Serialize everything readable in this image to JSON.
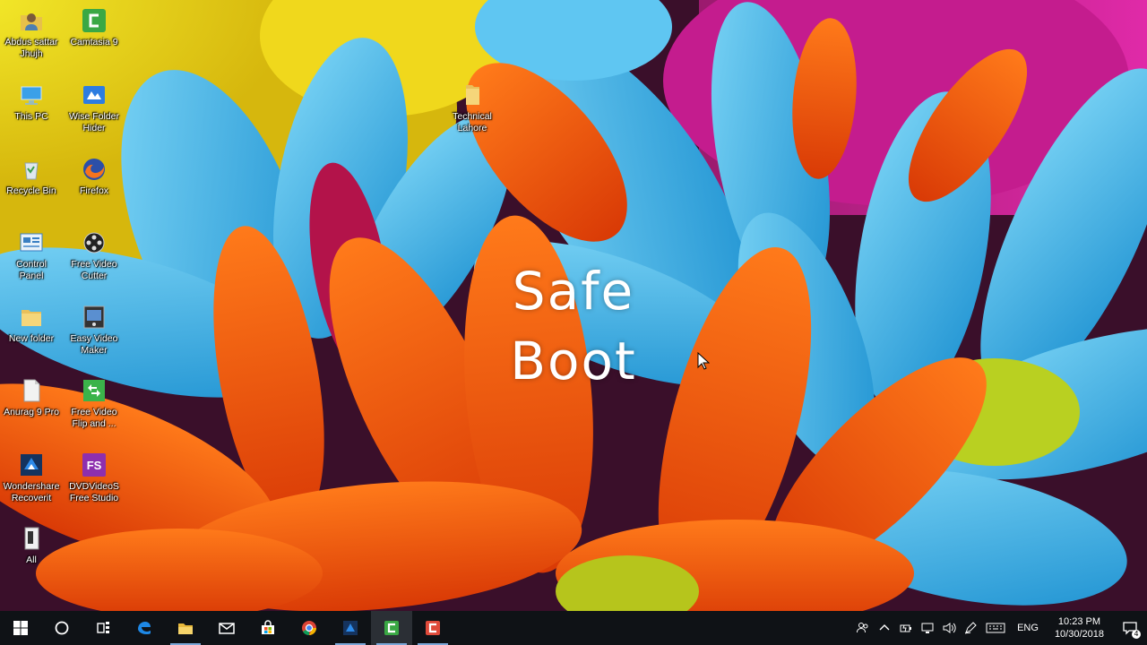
{
  "desktop": {
    "icons": [
      {
        "id": "abdus",
        "label": "Abdus sattar\nJhujh",
        "icon": "user-folder-icon"
      },
      {
        "id": "camtasia",
        "label": "Camtasia 9",
        "icon": "camtasia-icon"
      },
      {
        "id": "thispc",
        "label": "This PC",
        "icon": "computer-icon"
      },
      {
        "id": "wisefolder",
        "label": "Wise Folder\nHider",
        "icon": "wise-folder-icon"
      },
      {
        "id": "recycle",
        "label": "Recycle Bin",
        "icon": "recycle-bin-icon"
      },
      {
        "id": "firefox",
        "label": "Firefox",
        "icon": "firefox-icon"
      },
      {
        "id": "control",
        "label": "Control\nPanel",
        "icon": "control-panel-icon"
      },
      {
        "id": "fvcutter",
        "label": "Free Video\nCutter",
        "icon": "film-reel-icon"
      },
      {
        "id": "newfolder",
        "label": "New folder",
        "icon": "folder-icon"
      },
      {
        "id": "easyvideo",
        "label": "Easy Video\nMaker",
        "icon": "video-maker-icon"
      },
      {
        "id": "anurag",
        "label": "Anurag 9 Pro",
        "icon": "document-icon"
      },
      {
        "id": "fvflip",
        "label": "Free Video\nFlip and ...",
        "icon": "video-flip-icon"
      },
      {
        "id": "wondershare",
        "label": "Wondershare\nRecoverit",
        "icon": "recoverit-icon"
      },
      {
        "id": "dvdvideosoft",
        "label": "DVDVideoS\nFree Studio",
        "icon": "free-studio-icon"
      },
      {
        "id": "all",
        "label": "All",
        "icon": "document-icon"
      },
      {
        "id": "technical",
        "label": "Technical\nLahore",
        "icon": "folder-icon"
      }
    ],
    "free_studio_badge": "FS"
  },
  "overlay": {
    "line1": "Safe",
    "line2": "Boot"
  },
  "taskbar": {
    "pinned": [
      "windows-start-icon",
      "cortana-circle-icon",
      "task-view-icon",
      "edge-icon",
      "file-explorer-icon",
      "mail-icon",
      "store-icon",
      "chrome-icon",
      "wondershare-icon",
      "camtasia-icon",
      "camtasia-recorder-icon"
    ],
    "tray": {
      "language": "ENG",
      "time": "10:23 PM",
      "date": "10/30/2018",
      "notification_count": "4"
    }
  },
  "colors": {
    "taskbar_bg": "#0f1216",
    "accent": "#7aa7d8"
  }
}
